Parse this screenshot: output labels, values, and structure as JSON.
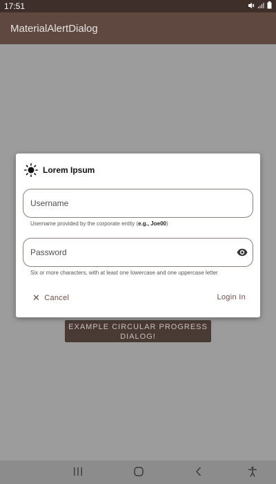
{
  "status_bar": {
    "time": "17:51"
  },
  "app_bar": {
    "title": "MaterialAlertDialog"
  },
  "background_button": {
    "label": "EXAMPLE CIRCULAR PROGRESS DIALOG!"
  },
  "dialog": {
    "title": "Lorem Ipsum",
    "title_icon": "sun-icon",
    "username": {
      "label": "Username",
      "helper_prefix": "Username provided by the corporate entity (",
      "helper_bold": "e.g., Joe00",
      "helper_suffix": ")"
    },
    "password": {
      "label": "Password",
      "helper": "Six or more characters, with at least one lowercase and one uppercase letter",
      "toggle_icon": "eye-icon"
    },
    "cancel_label": "Cancel",
    "login_label": "Login In"
  },
  "nav_bar": {
    "icons": [
      "recents-icon",
      "home-icon",
      "back-icon",
      "accessibility-icon"
    ]
  },
  "colors": {
    "status_bar": "#3e2f2a",
    "app_bar": "#5e4840",
    "scrim_background": "#9c9c9c",
    "button_background": "#4a3a34",
    "dialog_action": "#6b4d42"
  }
}
